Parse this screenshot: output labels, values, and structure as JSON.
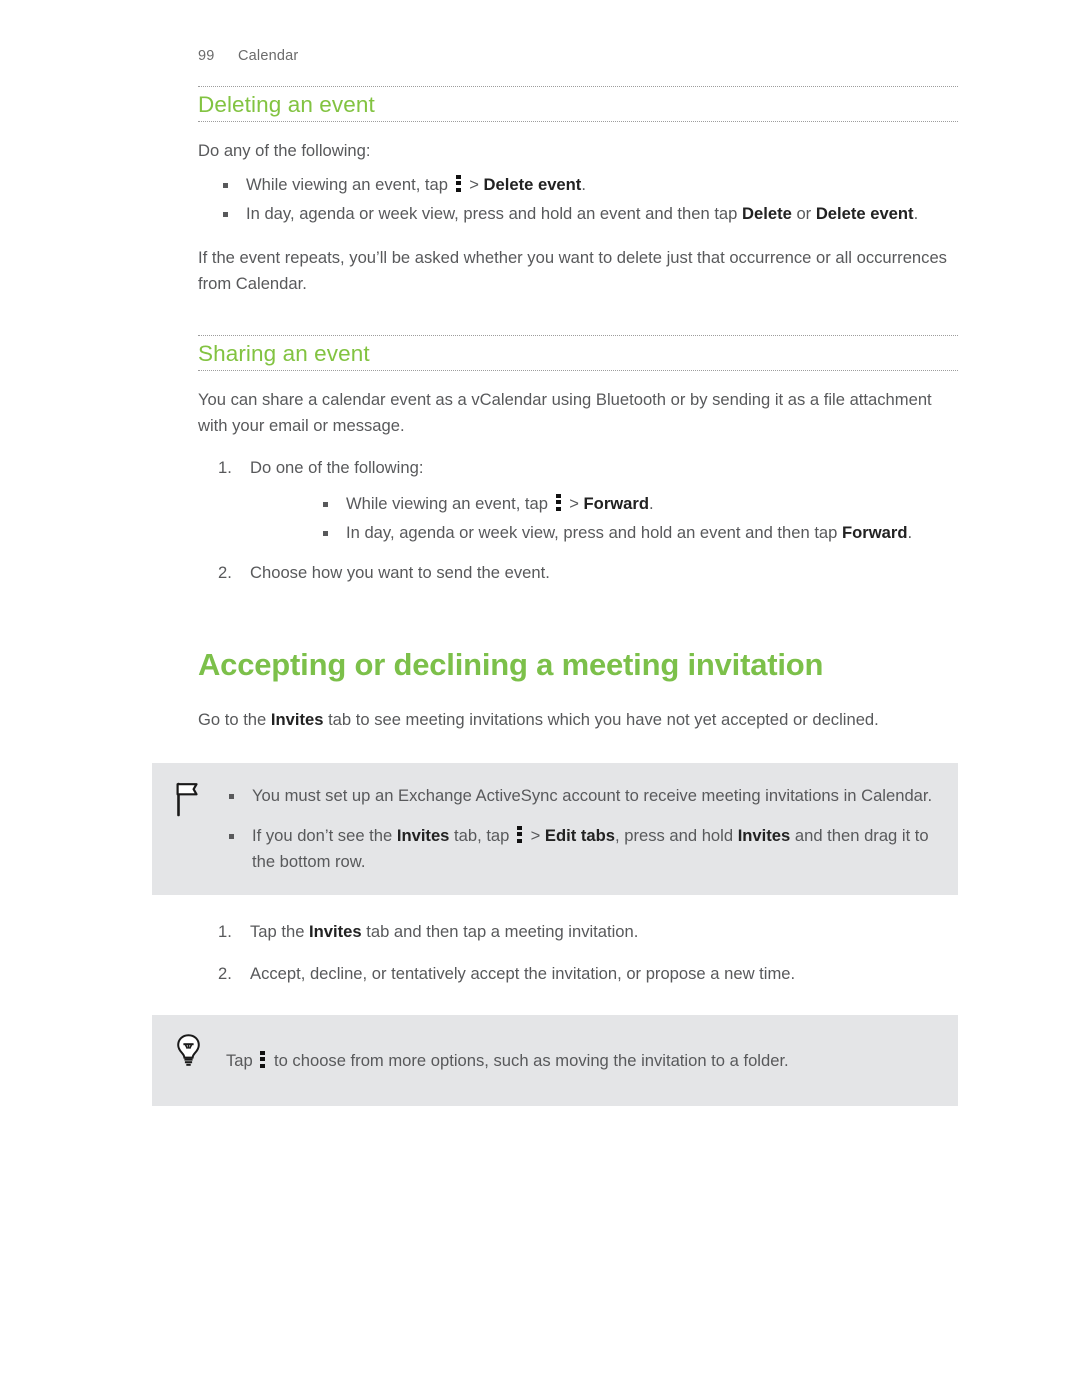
{
  "header": {
    "page_number": "99",
    "chapter": "Calendar"
  },
  "colors": {
    "heading_green": "#82c341",
    "chapter_green": "#7cc04a",
    "callout_bg": "#e4e5e7",
    "body_text": "#58595b"
  },
  "sections": {
    "deleting": {
      "heading": "Deleting an event",
      "intro": "Do any of the following:",
      "bullets": [
        {
          "pre": "While viewing an event, tap ",
          "icon": "kebab-menu-icon",
          "mid": " > ",
          "bold": "Delete event",
          "post": "."
        },
        {
          "pre": "In day, agenda or week view, press and hold an event and then tap ",
          "bold": "Delete",
          "mid2": " or ",
          "bold2": "Delete event",
          "post": "."
        }
      ],
      "closing": "If the event repeats, you’ll be asked whether you want to delete just that occurrence or all occurrences from Calendar."
    },
    "sharing": {
      "heading": "Sharing an event",
      "intro": "You can share a calendar event as a vCalendar using Bluetooth or by sending it as a file attachment with your email or message.",
      "step1": "Do one of the following:",
      "step1_bullets": [
        {
          "pre": "While viewing an event, tap ",
          "icon": "kebab-menu-icon",
          "mid": " > ",
          "bold": "Forward",
          "post": "."
        },
        {
          "pre": "In day, agenda or week view, press and hold an event and then tap ",
          "bold": "Forward",
          "post": "."
        }
      ],
      "step2": "Choose how you want to send the event."
    },
    "accepting": {
      "heading": "Accepting or declining a meeting invitation",
      "intro_pre": "Go to the ",
      "intro_bold": "Invites",
      "intro_post": " tab to see meeting invitations which you have not yet accepted or declined.",
      "note": {
        "icon": "flag-icon",
        "bullets": [
          {
            "text": "You must set up an Exchange ActiveSync account to receive meeting invitations in Calendar."
          },
          {
            "pre": "If you don’t see the ",
            "bold": "Invites",
            "mid": " tab, tap ",
            "icon": "kebab-menu-icon",
            "mid2": " > ",
            "bold2": "Edit tabs",
            "mid3": ", press and hold ",
            "bold3": "Invites",
            "post": " and then drag it to the bottom row."
          }
        ]
      },
      "steps": [
        {
          "pre": "Tap the ",
          "bold": "Invites",
          "post": " tab and then tap a meeting invitation."
        },
        {
          "pre": "Accept, decline, or tentatively accept the invitation, or propose a new time."
        }
      ],
      "tip": {
        "icon": "lightbulb-icon",
        "pre": "Tap ",
        "kebab": "kebab-menu-icon",
        "post": " to choose from more options, such as moving the invitation to a folder."
      }
    }
  }
}
